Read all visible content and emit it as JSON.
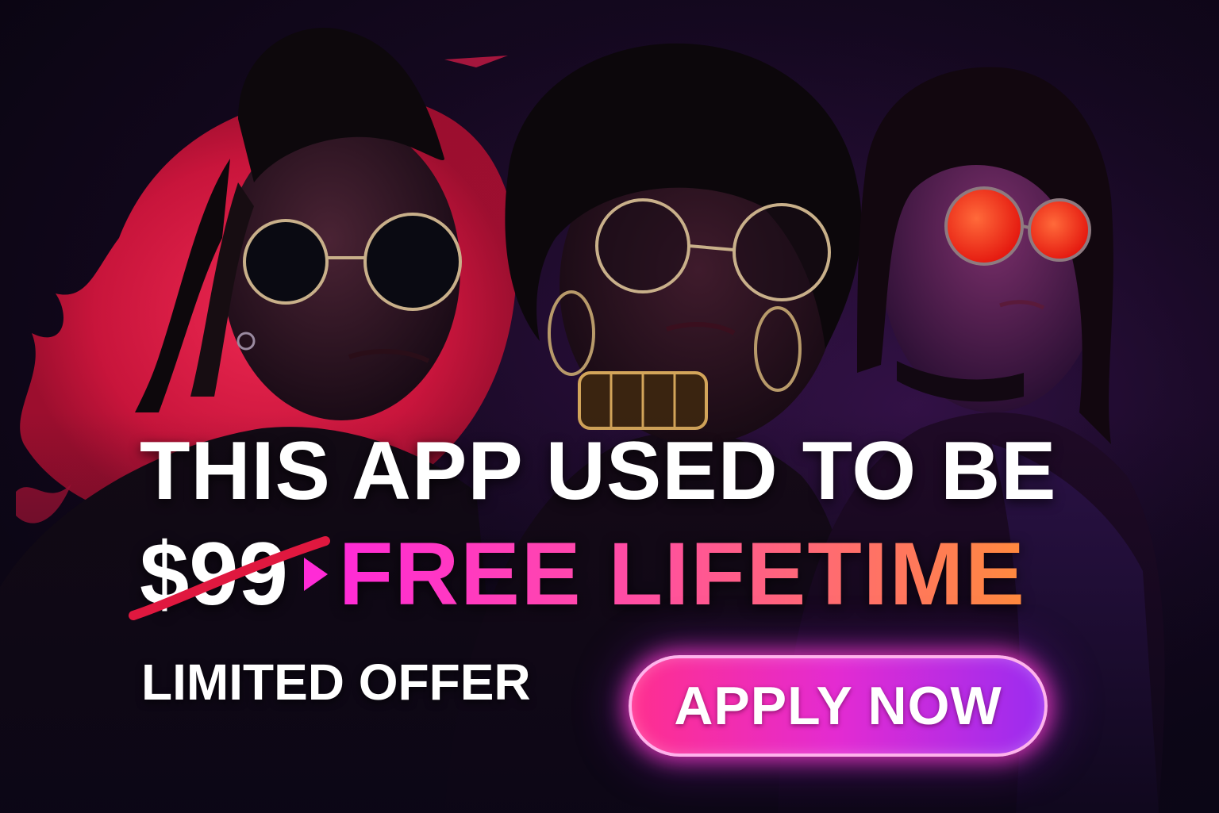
{
  "ad": {
    "headline": "THIS APP USED TO BE",
    "old_price": "$99",
    "new_price": "FREE LIFETIME",
    "limited": "LIMITED OFFER",
    "cta_label": "APPLY NOW"
  },
  "colors": {
    "background": "#0b0616",
    "accent_red": "#e0183f",
    "accent_magenta": "#ff2bd6",
    "accent_orange": "#ff8a3d",
    "cta_pink": "#ff2f8f",
    "cta_purple": "#9a2cf0",
    "lens_glow": "#ff3a1a",
    "text": "#ffffff"
  },
  "icons": {
    "separator": "triangle-arrow-right-icon"
  }
}
